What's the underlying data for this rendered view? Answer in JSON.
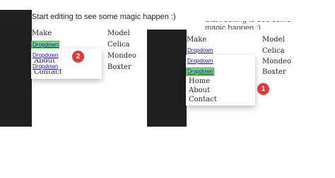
{
  "banner": {
    "text": "Start editing to see some magic happen :)"
  },
  "table_left": {
    "headers": {
      "make": "Make",
      "model": "Model"
    },
    "models": [
      "Celica",
      "Mondeo",
      "Boxter"
    ],
    "dropdowns": [
      "Dropdown",
      "Dropdown",
      "Dropdown"
    ],
    "menu_items": [
      "About",
      "Contact"
    ],
    "badge": "2"
  },
  "table_right": {
    "headers": {
      "make": "Make",
      "model": "Model"
    },
    "models": [
      "Celica",
      "Mondeo",
      "Boxter"
    ],
    "dropdowns": [
      "Dropdown",
      "Dropdown",
      "Dropdown"
    ],
    "menu_items": [
      "Home",
      "About",
      "Contact"
    ],
    "badge": "1"
  },
  "colors": {
    "active_dropdown": "#7ddc8a",
    "badge": "#e2393d",
    "dark_panel": "#1f1f1f"
  }
}
